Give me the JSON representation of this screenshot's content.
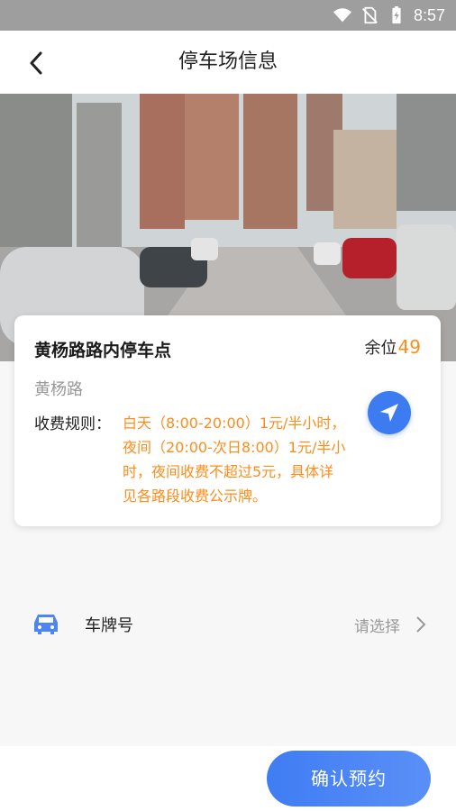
{
  "status_bar": {
    "time": "8:57",
    "icons": [
      "wifi-icon",
      "no-sim-icon",
      "battery-icon"
    ]
  },
  "header": {
    "title": "停车场信息",
    "back_icon": "chevron-left-icon"
  },
  "lot": {
    "name": "黄杨路路内停车点",
    "spaces_label": "余位",
    "spaces_count": "49",
    "road": "黄杨路",
    "rule_label": "收费规则：",
    "rule_text": "白天（8:00-20:00）1元/半小时，夜间（20:00-次日8:00）1元/半小时，夜间收费不超过5元，具体详见各路段收费公示牌。",
    "navigate_icon": "navigation-arrow-icon"
  },
  "plate": {
    "label": "车牌号",
    "placeholder": "请选择",
    "icon": "car-icon"
  },
  "footer": {
    "confirm_label": "确认预约"
  },
  "colors": {
    "accent": "#3d7bf0",
    "highlight": "#ff8c1a",
    "muted": "#999999"
  }
}
